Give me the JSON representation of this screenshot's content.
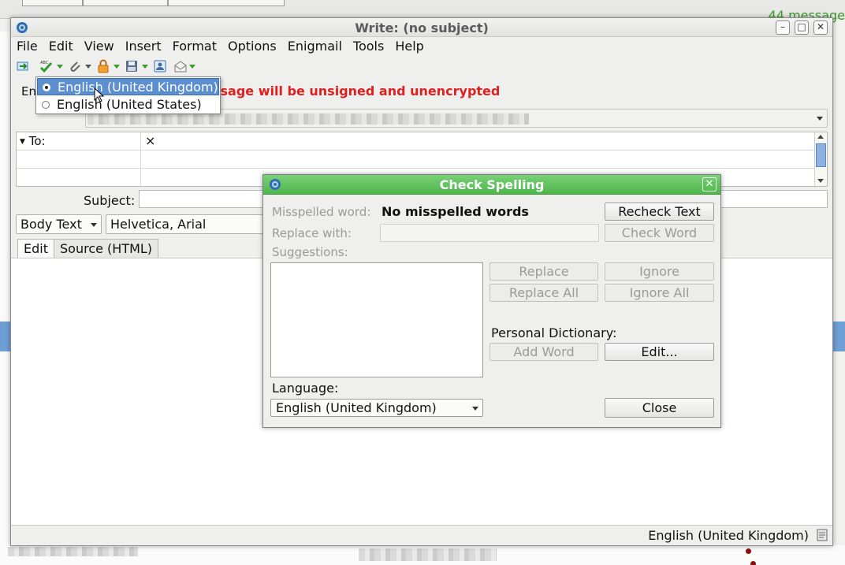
{
  "background": {
    "message_count_text": "44 message"
  },
  "window": {
    "title": "Write: (no subject)",
    "minimize_glyph": "–",
    "maximize_glyph": "□",
    "close_glyph": "✕"
  },
  "menubar": [
    "File",
    "Edit",
    "View",
    "Insert",
    "Format",
    "Options",
    "Enigmail",
    "Tools",
    "Help"
  ],
  "toolbar": {
    "icons": [
      "send-icon",
      "spellcheck-icon",
      "attach-icon",
      "security-lock-icon",
      "save-icon",
      "address-book-icon",
      "receipt-icon"
    ]
  },
  "enigmail": {
    "label_visible": "En",
    "warning": "ssage will be unsigned and unencrypted"
  },
  "addressing": {
    "type_label": "To:",
    "remove_glyph": "×"
  },
  "subject": {
    "label": "Subject:",
    "value": ""
  },
  "format_bar": {
    "paragraph_style": "Body Text",
    "font": "Helvetica, Arial"
  },
  "tabs": {
    "edit": "Edit",
    "source": "Source (HTML)"
  },
  "statusbar": {
    "language": "English (United Kingdom)"
  },
  "language_popup": {
    "items": [
      {
        "label": "English (United Kingdom)",
        "selected": true
      },
      {
        "label": "English (United States)",
        "selected": false
      }
    ]
  },
  "spell_dialog": {
    "title": "Check Spelling",
    "close_glyph": "✕",
    "misspelled_label": "Misspelled word:",
    "misspelled_value": "No misspelled words",
    "replace_with_label": "Replace with:",
    "suggestions_label": "Suggestions:",
    "personal_dictionary_label": "Personal Dictionary:",
    "language_label": "Language:",
    "language_value": "English (United Kingdom)",
    "buttons": {
      "recheck": "Recheck Text",
      "check_word": "Check Word",
      "replace": "Replace",
      "ignore": "Ignore",
      "replace_all": "Replace All",
      "ignore_all": "Ignore All",
      "add_word": "Add Word",
      "edit": "Edit...",
      "close": "Close"
    }
  },
  "colors": {
    "warning": "#e02020",
    "dialog_title": "#4fb64c",
    "selection": "#5b8fd0",
    "toolbar_accent": "#3a9a2a"
  }
}
